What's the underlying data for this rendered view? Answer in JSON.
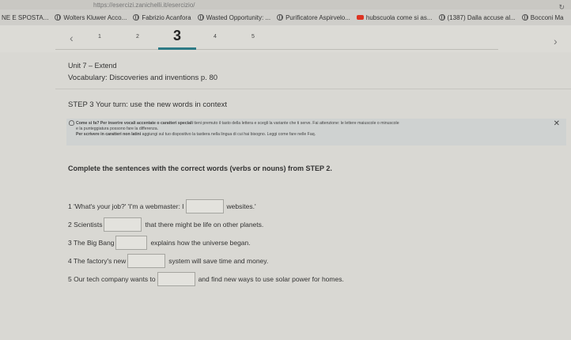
{
  "browser": {
    "url": "https://esercizi.zanichelli.it/esercizio/",
    "bookmarks": [
      {
        "label": "NE E SPOSTA...",
        "icon": "none"
      },
      {
        "label": "Wolters Kluwer Acco...",
        "icon": "globe-icon"
      },
      {
        "label": "Fabrizio Acanfora",
        "icon": "globe-icon"
      },
      {
        "label": "Wasted Opportunity: ...",
        "icon": "globe-icon"
      },
      {
        "label": "Purificatore Aspirvelo...",
        "icon": "globe-icon"
      },
      {
        "label": "hubscuola come si as...",
        "icon": "youtube-icon"
      },
      {
        "label": "(1387) Dalla accuse al...",
        "icon": "globe-icon"
      },
      {
        "label": "Bocconi Ma",
        "icon": "globe-icon"
      }
    ]
  },
  "pager": {
    "prev": "‹",
    "next": "›",
    "pages": [
      "1",
      "2",
      "3",
      "4",
      "5"
    ],
    "active": "3"
  },
  "content": {
    "unit": "Unit 7 – Extend",
    "vocab": "Vocabulary: Discoveries and inventions p. 80",
    "step": "STEP 3 Your turn: use the new words in context",
    "hint": {
      "line1_bold": "Come si fa? Per inserire vocali accentate o caratteri speciali",
      "line1_rest": " tieni premuto il tasto della lettera e scegli la variante che ti serve. Fai attenzione: le lettere maiuscole o minuscole",
      "line2": "e la punteggiatura possono fare la differenza.",
      "line3_bold": "Per scrivere in caratteri non latini",
      "line3_rest": " aggiungi sul tuo dispositivo la tastiera nella lingua di cui hai bisogno. Leggi come fare nelle Faq.",
      "close": "✕"
    },
    "instructions": "Complete the sentences with the correct words (verbs or nouns) from STEP 2.",
    "sentences": [
      {
        "before": "1 'What's your job?' 'I'm a webmaster: I",
        "after": "websites.'"
      },
      {
        "before": "2 Scientists",
        "after": "that there might be life on other planets."
      },
      {
        "before": "3 The Big Bang",
        "after": "explains how the universe began."
      },
      {
        "before": "4 The factory's new",
        "after": "system will save time and money."
      },
      {
        "before": "5 Our tech company wants to",
        "after": "and find new ways to use solar power for homes."
      }
    ]
  }
}
